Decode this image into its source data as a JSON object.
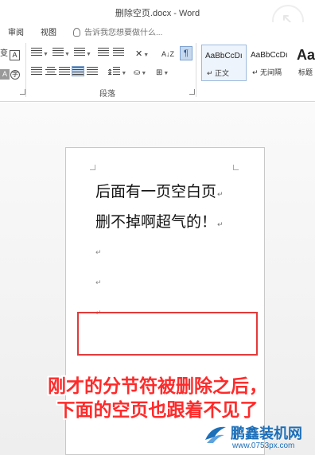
{
  "window": {
    "title": "删除空页.docx - Word"
  },
  "tabs": {
    "review": "审阅",
    "view": "视图",
    "tell_me": "告诉我您想要做什么..."
  },
  "ribbon": {
    "font_glyph_1": "变",
    "font_glyph_2": "A",
    "font_glyph_3": "A",
    "font_glyph_4": "字",
    "sort_label": "A↓Z",
    "paragraph_group": "段落",
    "styles": [
      {
        "sample": "AaBbCcDı",
        "name": "↵ 正文"
      },
      {
        "sample": "AaBbCcDı",
        "name": "↵ 无间隔"
      },
      {
        "sample": "Aa",
        "name": "标题"
      }
    ]
  },
  "document": {
    "line1": "后面有一页空白页",
    "line2": "删不掉啊超气的！",
    "paragraph_mark": "↵"
  },
  "caption": {
    "line1": "刚才的分节符被删除之后，",
    "line2": "下面的空页也跟着不见了"
  },
  "watermark": {
    "brand": "鹏鑫装机网",
    "url": "www.0753px.com"
  },
  "colors": {
    "annotation_red": "#ff2a2a",
    "brand_blue": "#1d6fb8"
  }
}
